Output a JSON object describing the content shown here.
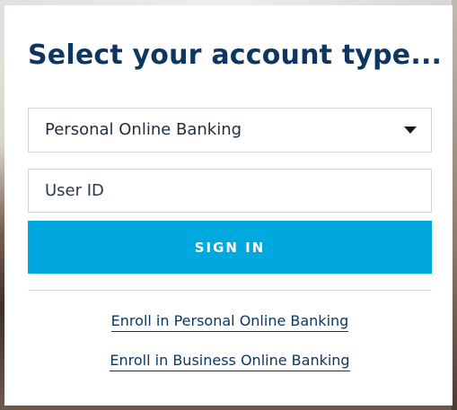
{
  "login_card": {
    "title": "Select your account type...",
    "account_type": {
      "selected": "Personal Online Banking"
    },
    "user_id": {
      "placeholder": "User ID",
      "value": ""
    },
    "sign_in_label": "SIGN IN",
    "links": {
      "enroll_personal": "Enroll in Personal Online Banking",
      "enroll_business": "Enroll in Business Online Banking"
    }
  },
  "colors": {
    "title": "#0e3660",
    "button": "#00a8e0",
    "button_text": "#ffffff",
    "link": "#0e3660",
    "border": "#d4d4d4"
  }
}
